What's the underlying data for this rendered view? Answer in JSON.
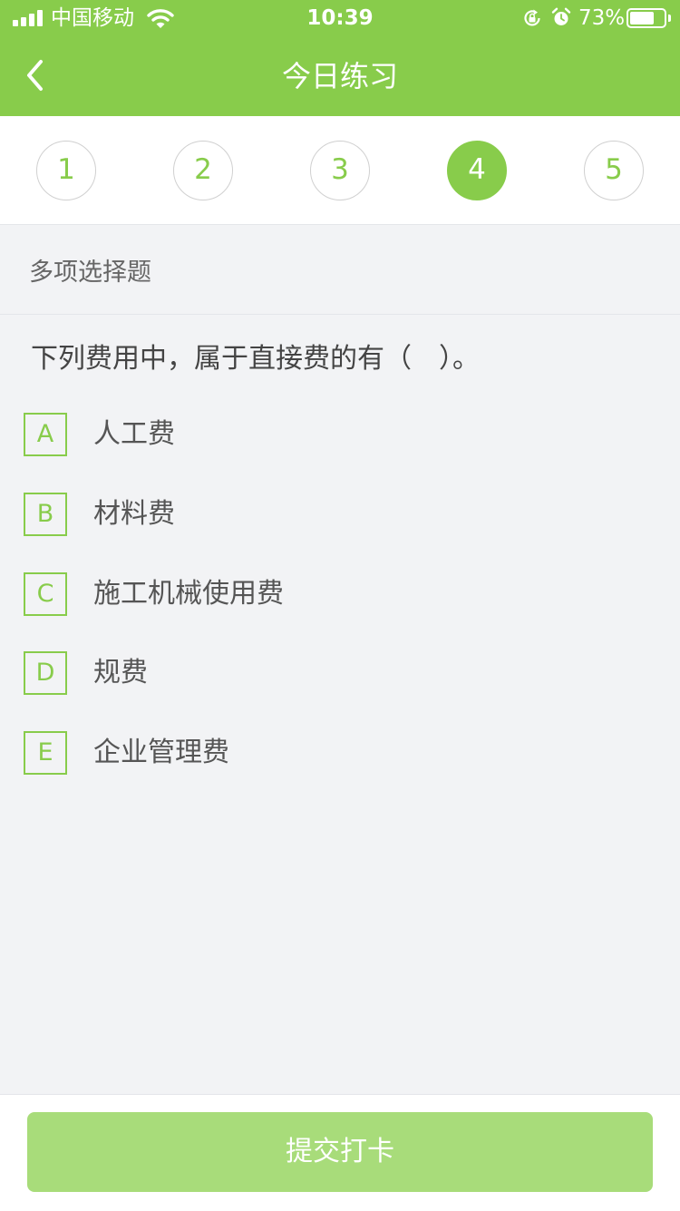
{
  "status_bar": {
    "carrier": "中国移动",
    "time": "10:39",
    "battery_percent": "73%",
    "battery_level": 0.73,
    "icons": [
      "signal-icon",
      "wifi-icon",
      "rotation-lock-icon",
      "alarm-icon",
      "battery-icon"
    ]
  },
  "nav": {
    "title": "今日练习",
    "back_icon": "chevron-left-icon"
  },
  "steps": {
    "items": [
      {
        "label": "1"
      },
      {
        "label": "2"
      },
      {
        "label": "3"
      },
      {
        "label": "4"
      },
      {
        "label": "5"
      }
    ],
    "current_label": "4"
  },
  "question": {
    "type": "多项选择题",
    "text": "下列费用中，属于直接费的有（　）。",
    "options": [
      {
        "letter": "A",
        "text": "人工费"
      },
      {
        "letter": "B",
        "text": "材料费"
      },
      {
        "letter": "C",
        "text": "施工机械使用费"
      },
      {
        "letter": "D",
        "text": "规费"
      },
      {
        "letter": "E",
        "text": "企业管理费"
      }
    ]
  },
  "footer": {
    "submit_label": "提交打卡"
  },
  "colors": {
    "accent": "#88cc4b",
    "button_disabled": "#a8dc7a",
    "background": "#f2f3f5"
  }
}
